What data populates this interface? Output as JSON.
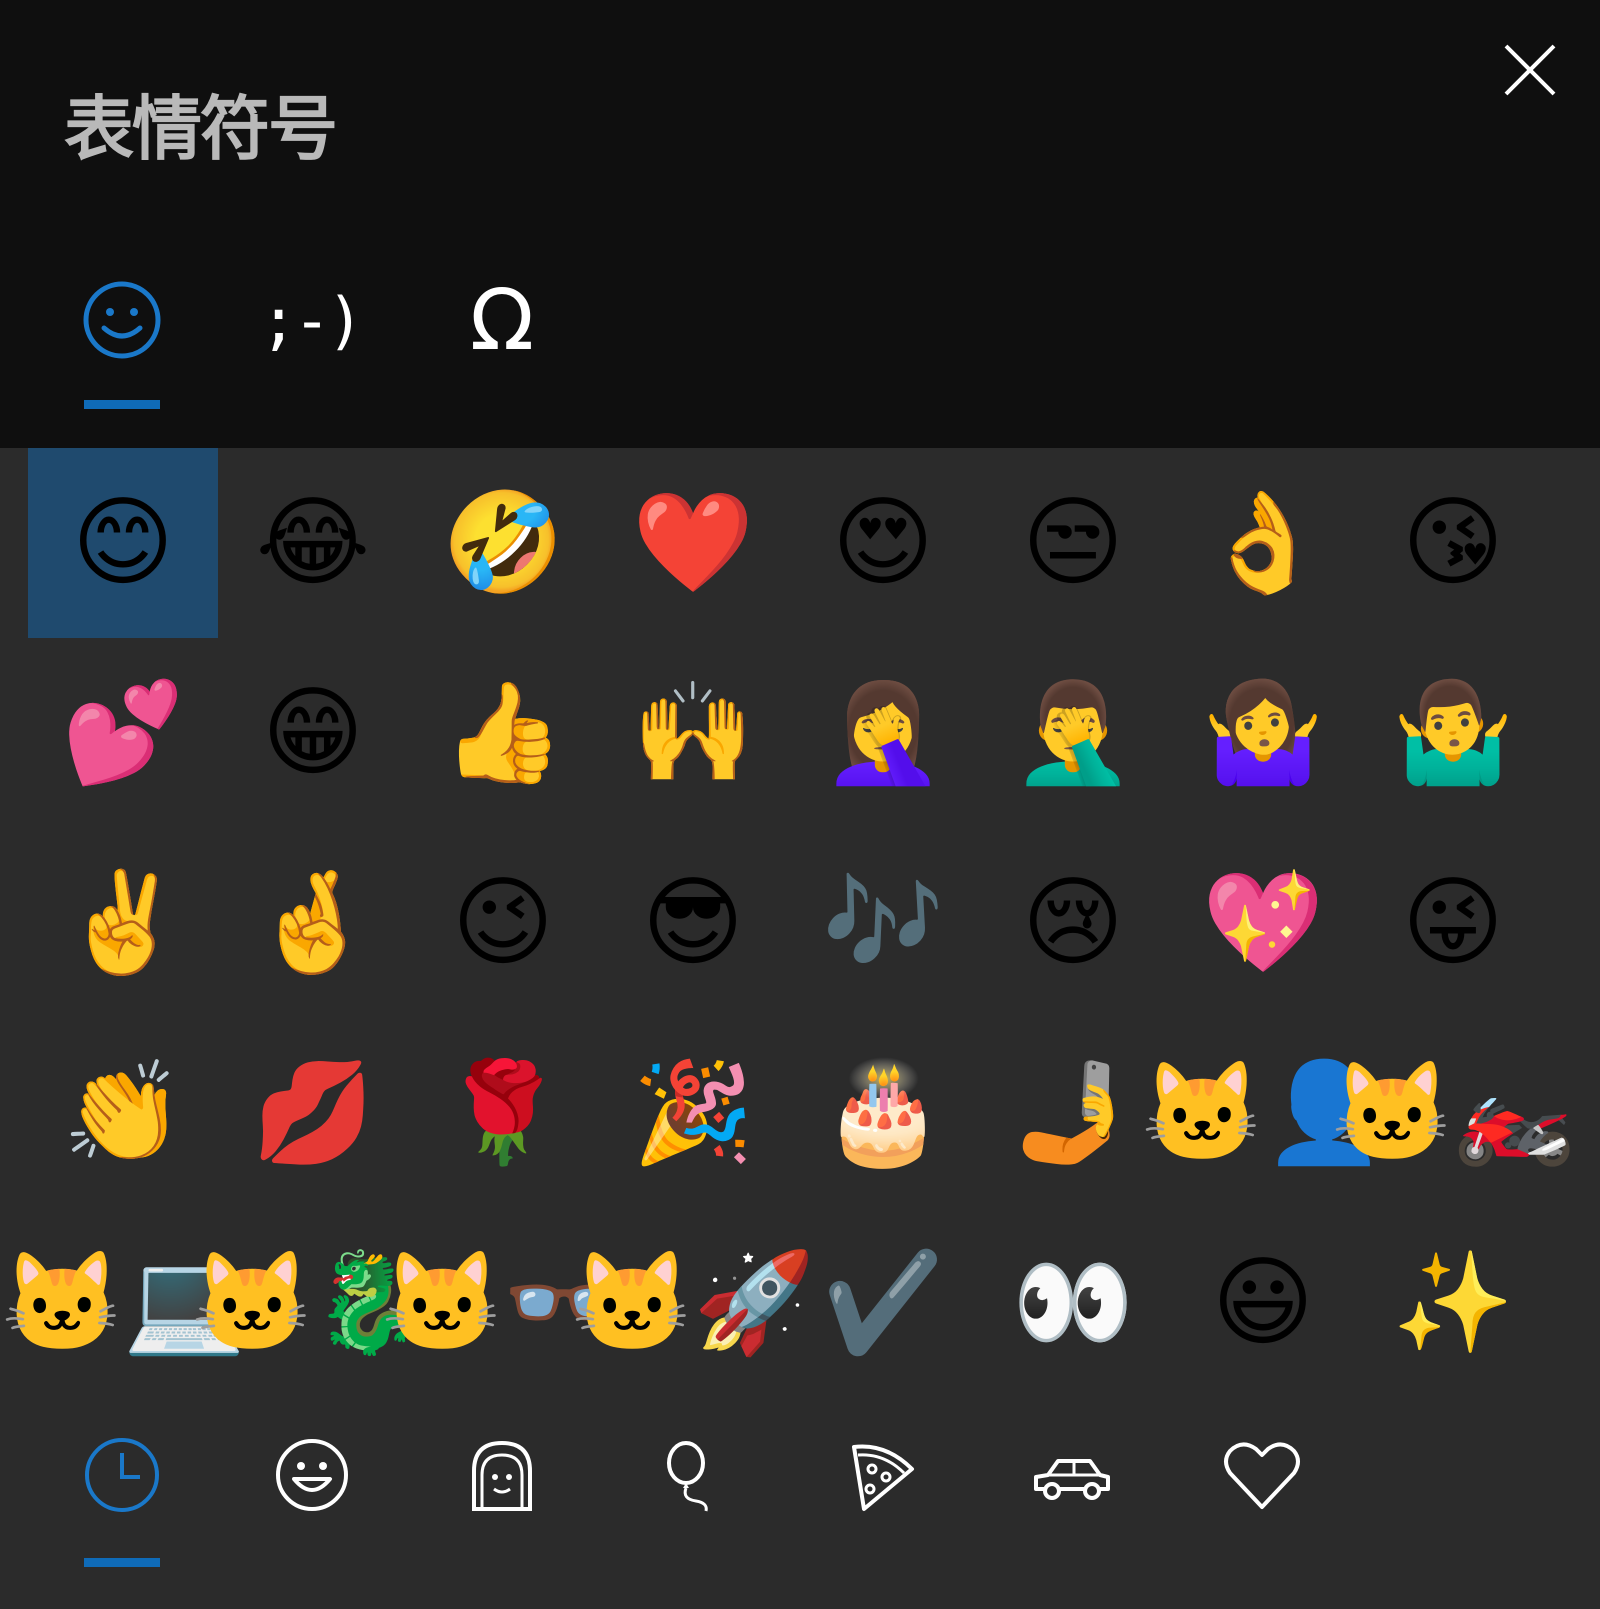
{
  "title": "表情符号",
  "header_tabs": [
    {
      "name": "emoji",
      "icon": "smiley-outline-icon",
      "active": true
    },
    {
      "name": "kaomoji",
      "label": ";-)",
      "active": false
    },
    {
      "name": "symbols",
      "label": "Ω",
      "active": false
    }
  ],
  "emoji_grid": [
    "😊",
    "😂",
    "🤣",
    "❤️",
    "😍",
    "😒",
    "👌",
    "😘",
    "💕",
    "😁",
    "👍",
    "🙌",
    "🤦‍♀️",
    "🤦‍♂️",
    "🤷‍♀️",
    "🤷‍♂️",
    "✌️",
    "🤞",
    "😉",
    "😎",
    "🎶",
    "😢",
    "💖",
    "😜",
    "👏",
    "💋",
    "🌹",
    "🎉",
    "🎂",
    "🤳",
    "🐱‍👤",
    "🐱‍🏍",
    "🐱‍💻",
    "🐱‍🐉",
    "🐱‍👓",
    "🐱‍🚀",
    "✔️",
    "👀",
    "😃",
    "✨"
  ],
  "selected_index": 0,
  "categories": [
    {
      "name": "recent",
      "icon": "clock-icon",
      "active": true
    },
    {
      "name": "smileys",
      "icon": "smiley-face-icon",
      "active": false
    },
    {
      "name": "people",
      "icon": "person-icon",
      "active": false
    },
    {
      "name": "celebrations",
      "icon": "balloon-icon",
      "active": false
    },
    {
      "name": "food",
      "icon": "pizza-icon",
      "active": false
    },
    {
      "name": "travel",
      "icon": "car-icon",
      "active": false
    },
    {
      "name": "symbols",
      "icon": "heart-outline-icon",
      "active": false
    }
  ],
  "colors": {
    "accent": "#0f6bb8",
    "header_bg": "#0f0f0f",
    "body_bg": "#2b2b2b",
    "selected_bg": "#1f4a6e"
  }
}
